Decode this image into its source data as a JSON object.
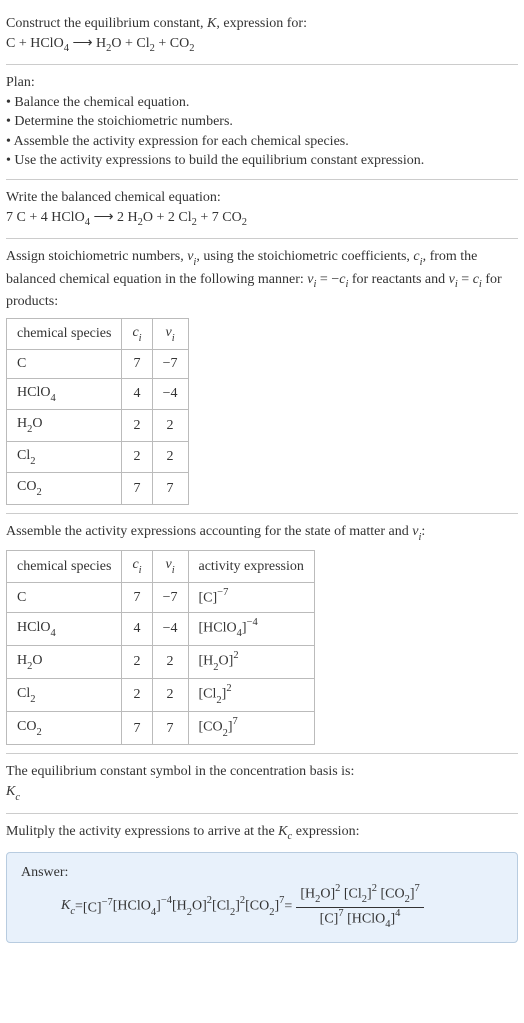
{
  "intro": {
    "line1": "Construct the equilibrium constant, ",
    "k": "K",
    "line1b": ", expression for:",
    "eq_lhs": "C + HClO",
    "eq_sub1": "4",
    "arrow": " ⟶ ",
    "eq_rhs1": "H",
    "eq_rhs1_sub": "2",
    "eq_rhs2": "O + Cl",
    "eq_rhs2_sub": "2",
    "eq_rhs3": " + CO",
    "eq_rhs3_sub": "2"
  },
  "plan": {
    "title": "Plan:",
    "b1": "• Balance the chemical equation.",
    "b2": "• Determine the stoichiometric numbers.",
    "b3": "• Assemble the activity expression for each chemical species.",
    "b4": "• Use the activity expressions to build the equilibrium constant expression."
  },
  "balanced": {
    "title": "Write the balanced chemical equation:",
    "lhs1": "7 C + 4 HClO",
    "lhs1_sub": "4",
    "arrow": " ⟶ ",
    "rhs1": "2 H",
    "rhs1_sub": "2",
    "rhs2": "O + 2 Cl",
    "rhs2_sub": "2",
    "rhs3": " + 7 CO",
    "rhs3_sub": "2"
  },
  "stoich": {
    "p1": "Assign stoichiometric numbers, ",
    "nu": "ν",
    "i": "i",
    "p2": ", using the stoichiometric coefficients, ",
    "c": "c",
    "p3": ", from the balanced chemical equation in the following manner: ",
    "eq1a": "ν",
    "eq1b": " = −",
    "eq1c": "c",
    "p4": " for reactants and ",
    "eq2a": "ν",
    "eq2b": " = ",
    "eq2c": "c",
    "p5": " for products:",
    "th1": "chemical species",
    "th2": "c",
    "th3": "ν",
    "r1c1": "C",
    "r1c2": "7",
    "r1c3": "−7",
    "r2c1a": "HClO",
    "r2c1_sub": "4",
    "r2c2": "4",
    "r2c3": "−4",
    "r3c1a": "H",
    "r3c1_sub": "2",
    "r3c1b": "O",
    "r3c2": "2",
    "r3c3": "2",
    "r4c1a": "Cl",
    "r4c1_sub": "2",
    "r4c2": "2",
    "r4c3": "2",
    "r5c1a": "CO",
    "r5c1_sub": "2",
    "r5c2": "7",
    "r5c3": "7"
  },
  "activity": {
    "p1": "Assemble the activity expressions accounting for the state of matter and ",
    "nu": "ν",
    "i": "i",
    "p2": ":",
    "th1": "chemical species",
    "th2": "c",
    "th3": "ν",
    "th4": "activity expression",
    "r1c1": "C",
    "r1c2": "7",
    "r1c3": "−7",
    "r1c4a": "[C]",
    "r1c4_sup": "−7",
    "r2c1a": "HClO",
    "r2c1_sub": "4",
    "r2c2": "4",
    "r2c3": "−4",
    "r2c4a": "[HClO",
    "r2c4_sub": "4",
    "r2c4b": "]",
    "r2c4_sup": "−4",
    "r3c1a": "H",
    "r3c1_sub": "2",
    "r3c1b": "O",
    "r3c2": "2",
    "r3c3": "2",
    "r3c4a": "[H",
    "r3c4_sub": "2",
    "r3c4b": "O]",
    "r3c4_sup": "2",
    "r4c1a": "Cl",
    "r4c1_sub": "2",
    "r4c2": "2",
    "r4c3": "2",
    "r4c4a": "[Cl",
    "r4c4_sub": "2",
    "r4c4b": "]",
    "r4c4_sup": "2",
    "r5c1a": "CO",
    "r5c1_sub": "2",
    "r5c2": "7",
    "r5c3": "7",
    "r5c4a": "[CO",
    "r5c4_sub": "2",
    "r5c4b": "]",
    "r5c4_sup": "7"
  },
  "symbol": {
    "p1": "The equilibrium constant symbol in the concentration basis is:",
    "k": "K",
    "c": "c"
  },
  "multiply": {
    "p1": "Mulitply the activity expressions to arrive at the ",
    "k": "K",
    "c": "c",
    "p2": " expression:"
  },
  "answer": {
    "title": "Answer:",
    "keq": "K",
    "keq_sub": "c",
    "eq": " = ",
    "t1a": "[C]",
    "t1_sup": "−7",
    "t2a": " [HClO",
    "t2_sub": "4",
    "t2b": "]",
    "t2_sup": "−4",
    "t3a": " [H",
    "t3_sub": "2",
    "t3b": "O]",
    "t3_sup": "2",
    "t4a": " [Cl",
    "t4_sub": "2",
    "t4b": "]",
    "t4_sup": "2",
    "t5a": " [CO",
    "t5_sub": "2",
    "t5b": "]",
    "t5_sup": "7",
    "eq2": " = ",
    "num1a": "[H",
    "num1_sub": "2",
    "num1b": "O]",
    "num1_sup": "2",
    "num2a": " [Cl",
    "num2_sub": "2",
    "num2b": "]",
    "num2_sup": "2",
    "num3a": " [CO",
    "num3_sub": "2",
    "num3b": "]",
    "num3_sup": "7",
    "den1a": "[C]",
    "den1_sup": "7",
    "den2a": " [HClO",
    "den2_sub": "4",
    "den2b": "]",
    "den2_sup": "4"
  }
}
